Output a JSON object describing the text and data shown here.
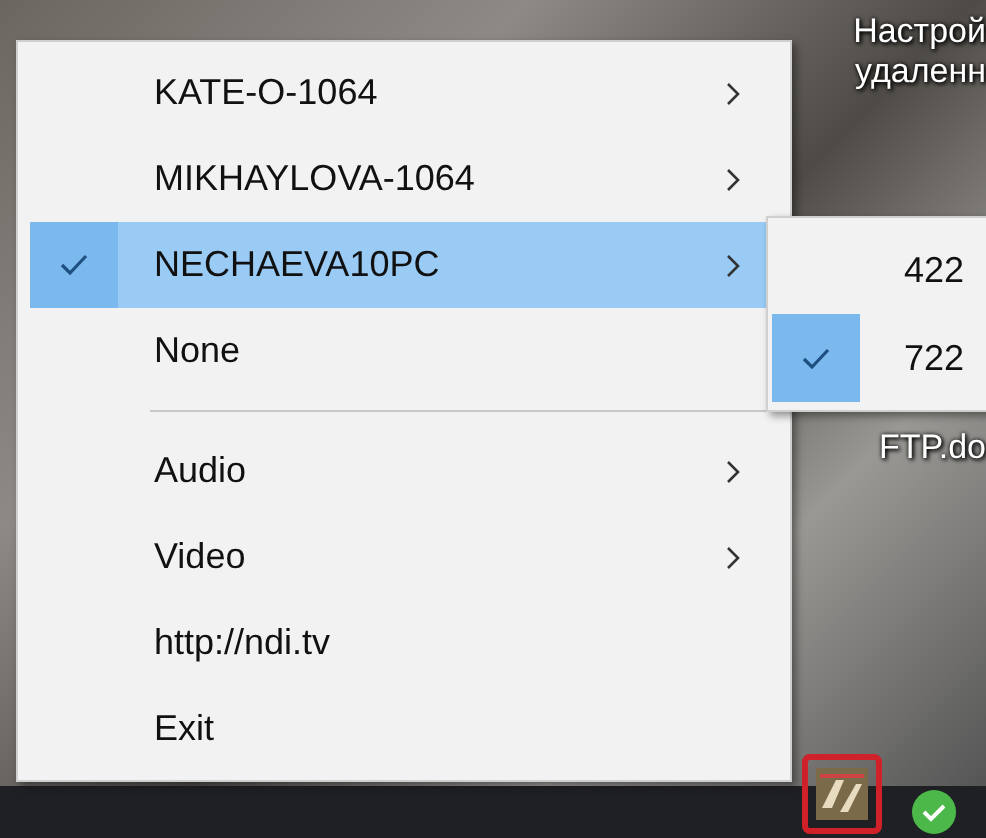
{
  "desktop": {
    "icon_labels": [
      {
        "label": "Настрой"
      },
      {
        "label": "удаленн"
      },
      {
        "label": "FTP.do"
      }
    ]
  },
  "menu": {
    "items": [
      {
        "kind": "item",
        "label": "KATE-O-1064",
        "checked": false,
        "selected": false,
        "submenu": true
      },
      {
        "kind": "item",
        "label": "MIKHAYLOVA-1064",
        "checked": false,
        "selected": false,
        "submenu": true
      },
      {
        "kind": "item",
        "label": "NECHAEVA10PC",
        "checked": true,
        "selected": true,
        "submenu": true
      },
      {
        "kind": "item",
        "label": "None",
        "checked": false,
        "selected": false,
        "submenu": false
      },
      {
        "kind": "separator"
      },
      {
        "kind": "item",
        "label": "Audio",
        "checked": false,
        "selected": false,
        "submenu": true
      },
      {
        "kind": "item",
        "label": "Video",
        "checked": false,
        "selected": false,
        "submenu": true
      },
      {
        "kind": "item",
        "label": "http://ndi.tv",
        "checked": false,
        "selected": false,
        "submenu": false
      },
      {
        "kind": "item",
        "label": "Exit",
        "checked": false,
        "selected": false,
        "submenu": false
      }
    ]
  },
  "submenu": {
    "items": [
      {
        "label": "422",
        "checked": false
      },
      {
        "label": "722",
        "checked": true
      }
    ]
  },
  "taskbar": {
    "tray_icon_highlighted": true
  }
}
